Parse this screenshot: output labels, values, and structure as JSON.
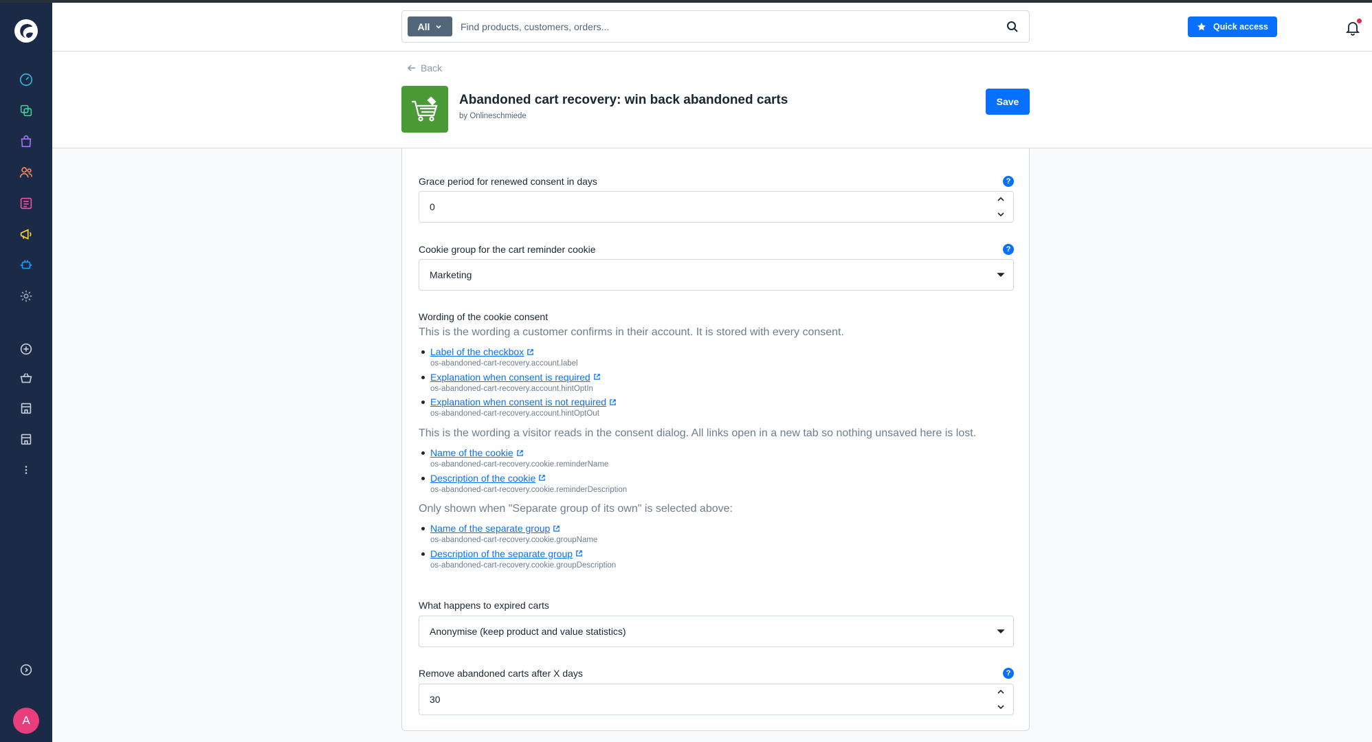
{
  "header": {
    "search_type": "All",
    "search_placeholder": "Find products, customers, orders...",
    "quick_access_label": "Quick access"
  },
  "sidebar": {
    "avatar_initial": "A",
    "items": [
      "dashboard",
      "catalogues",
      "orders",
      "customers",
      "content",
      "marketing",
      "extensions",
      "settings",
      "add",
      "sales-channel-basket",
      "sales-channel-store",
      "sales-channel-store-2",
      "more"
    ]
  },
  "page": {
    "back_label": "Back",
    "title": "Abandoned cart recovery: win back abandoned carts",
    "subtitle": "by Onlineschmiede",
    "save_label": "Save"
  },
  "form": {
    "grace": {
      "label": "Grace period for renewed consent in days",
      "value": "0"
    },
    "cookie_group": {
      "label": "Cookie group for the cart reminder cookie",
      "value": "Marketing"
    },
    "wording": {
      "title": "Wording of the cookie consent",
      "account_text": "This is the wording a customer confirms in their account. It is stored with every consent.",
      "account_links": [
        {
          "label": "Label of the checkbox",
          "key": "os-abandoned-cart-recovery.account.label"
        },
        {
          "label": "Explanation when consent is required",
          "key": "os-abandoned-cart-recovery.account.hintOptIn"
        },
        {
          "label": "Explanation when consent is not required",
          "key": "os-abandoned-cart-recovery.account.hintOptOut"
        }
      ],
      "visitor_text": "This is the wording a visitor reads in the consent dialog. All links open in a new tab so nothing unsaved here is lost.",
      "visitor_links": [
        {
          "label": "Name of the cookie",
          "key": "os-abandoned-cart-recovery.cookie.reminderName"
        },
        {
          "label": "Description of the cookie",
          "key": "os-abandoned-cart-recovery.cookie.reminderDescription"
        }
      ],
      "group_text": "Only shown when \"Separate group of its own\" is selected above:",
      "group_links": [
        {
          "label": "Name of the separate group",
          "key": "os-abandoned-cart-recovery.cookie.groupName"
        },
        {
          "label": "Description of the separate group",
          "key": "os-abandoned-cart-recovery.cookie.groupDescription"
        }
      ]
    },
    "expired": {
      "label": "What happens to expired carts",
      "value": "Anonymise (keep product and value statistics)"
    },
    "remove_after": {
      "label": "Remove abandoned carts after X days",
      "value": "30"
    }
  },
  "colors": {
    "sidebar_bg": "#1b2a46",
    "accent": "#0870ff",
    "app_icon_bg": "#4a9b38",
    "avatar_bg": "#e83e7d",
    "notification_dot": "#de294c"
  }
}
